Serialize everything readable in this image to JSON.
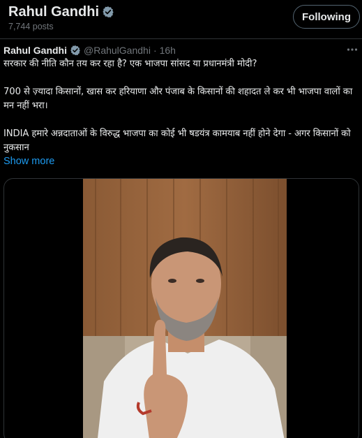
{
  "profile": {
    "name": "Rahul Gandhi",
    "posts_count": "7,744 posts",
    "follow_label": "Following"
  },
  "tweet": {
    "author_name": "Rahul Gandhi",
    "handle": "@RahulGandhi",
    "separator": "·",
    "time": "16h",
    "paragraphs": [
      "सरकार की नीति कौन तय कर रहा है? एक भाजपा सांसद या प्रधानमंत्री मोदी?",
      "700 से ज़्यादा किसानों, खास कर हरियाणा और पंजाब के किसानों की शहादत ले कर भी भाजपा वालों का मन नहीं भरा।",
      "INDIA हमारे अन्नदाताओं के विरुद्ध भाजपा का कोई भी षडयंत्र कामयाब नहीं होने देगा - अगर किसानों को नुकसान"
    ],
    "show_more_label": "Show more"
  },
  "colors": {
    "background": "#000000",
    "text_primary": "#e7e9ea",
    "text_secondary": "#71767b",
    "link": "#1d9bf0",
    "verified": "#829aab",
    "border": "#2f3336"
  },
  "icons": {
    "verified": "verified-badge-icon",
    "more": "more-options-icon"
  }
}
